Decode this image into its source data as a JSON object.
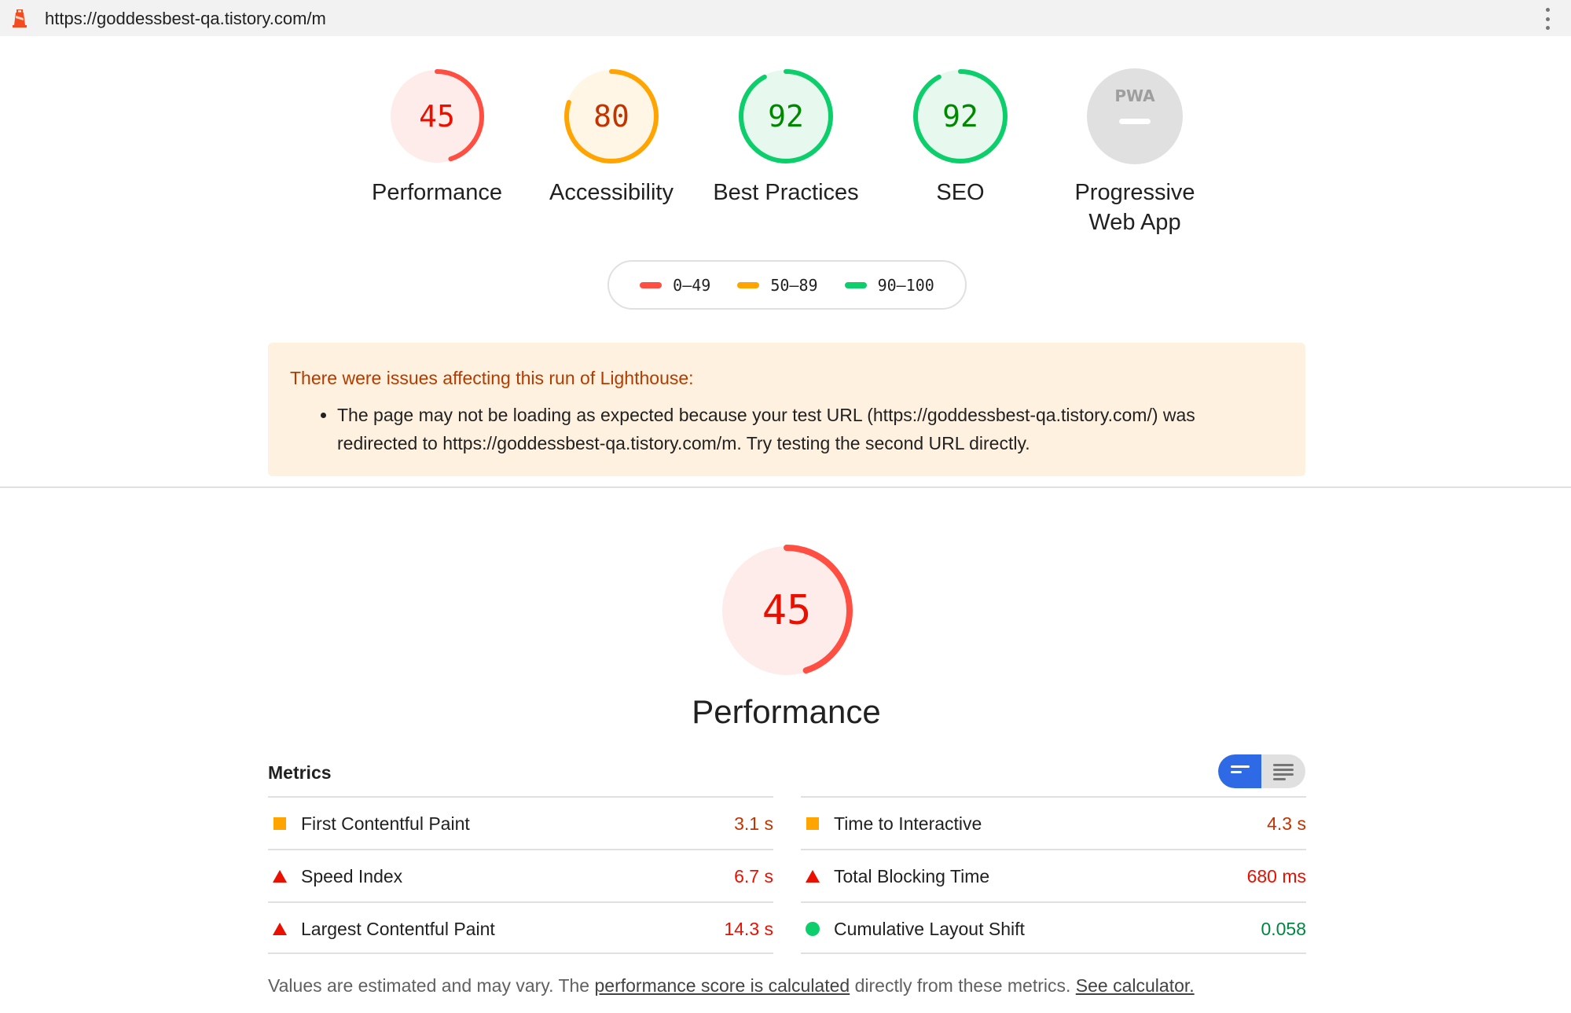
{
  "url_bar": {
    "url": "https://goddessbest-qa.tistory.com/m"
  },
  "gauges": [
    {
      "label": "Performance",
      "score": "45",
      "value": 45,
      "color": "#ff4e42",
      "fill": "#fdecea",
      "text_color": "#eb0f00"
    },
    {
      "label": "Accessibility",
      "score": "80",
      "value": 80,
      "color": "#ffa400",
      "fill": "#fff6e6",
      "text_color": "#c33300"
    },
    {
      "label": "Best Practices",
      "score": "92",
      "value": 92,
      "color": "#0cce6b",
      "fill": "#e7f9ef",
      "text_color": "#008800"
    },
    {
      "label": "SEO",
      "score": "92",
      "value": 92,
      "color": "#0cce6b",
      "fill": "#e7f9ef",
      "text_color": "#008800"
    },
    {
      "label_line1": "Progressive",
      "label_line2": "Web App",
      "badge": "PWA"
    }
  ],
  "legend": [
    {
      "range": "0–49",
      "color": "#ff4e42"
    },
    {
      "range": "50–89",
      "color": "#ffa400"
    },
    {
      "range": "90–100",
      "color": "#0cce6b"
    }
  ],
  "warning": {
    "heading": "There were issues affecting this run of Lighthouse:",
    "item_line1": "The page may not be loading as expected because your test URL (https://goddessbest-qa.tistory.com/) was",
    "item_line2": "redirected to https://goddessbest-qa.tistory.com/m. Try testing the second URL directly."
  },
  "performance": {
    "score": "45",
    "value": 45,
    "title": "Performance"
  },
  "metrics": {
    "heading": "Metrics",
    "left": [
      {
        "name": "First Contentful Paint",
        "value": "3.1 s",
        "indicator": "square"
      },
      {
        "name": "Speed Index",
        "value": "6.7 s",
        "indicator": "triangle"
      },
      {
        "name": "Largest Contentful Paint",
        "value": "14.3 s",
        "indicator": "triangle"
      }
    ],
    "right": [
      {
        "name": "Time to Interactive",
        "value": "4.3 s",
        "indicator": "square"
      },
      {
        "name": "Total Blocking Time",
        "value": "680 ms",
        "indicator": "triangle"
      },
      {
        "name": "Cumulative Layout Shift",
        "value": "0.058",
        "indicator": "circle"
      }
    ]
  },
  "footnote": {
    "text1": "Values are estimated and may vary. The ",
    "link1": "performance score is calculated",
    "text2": " directly from these metrics. ",
    "link2": "See calculator."
  }
}
